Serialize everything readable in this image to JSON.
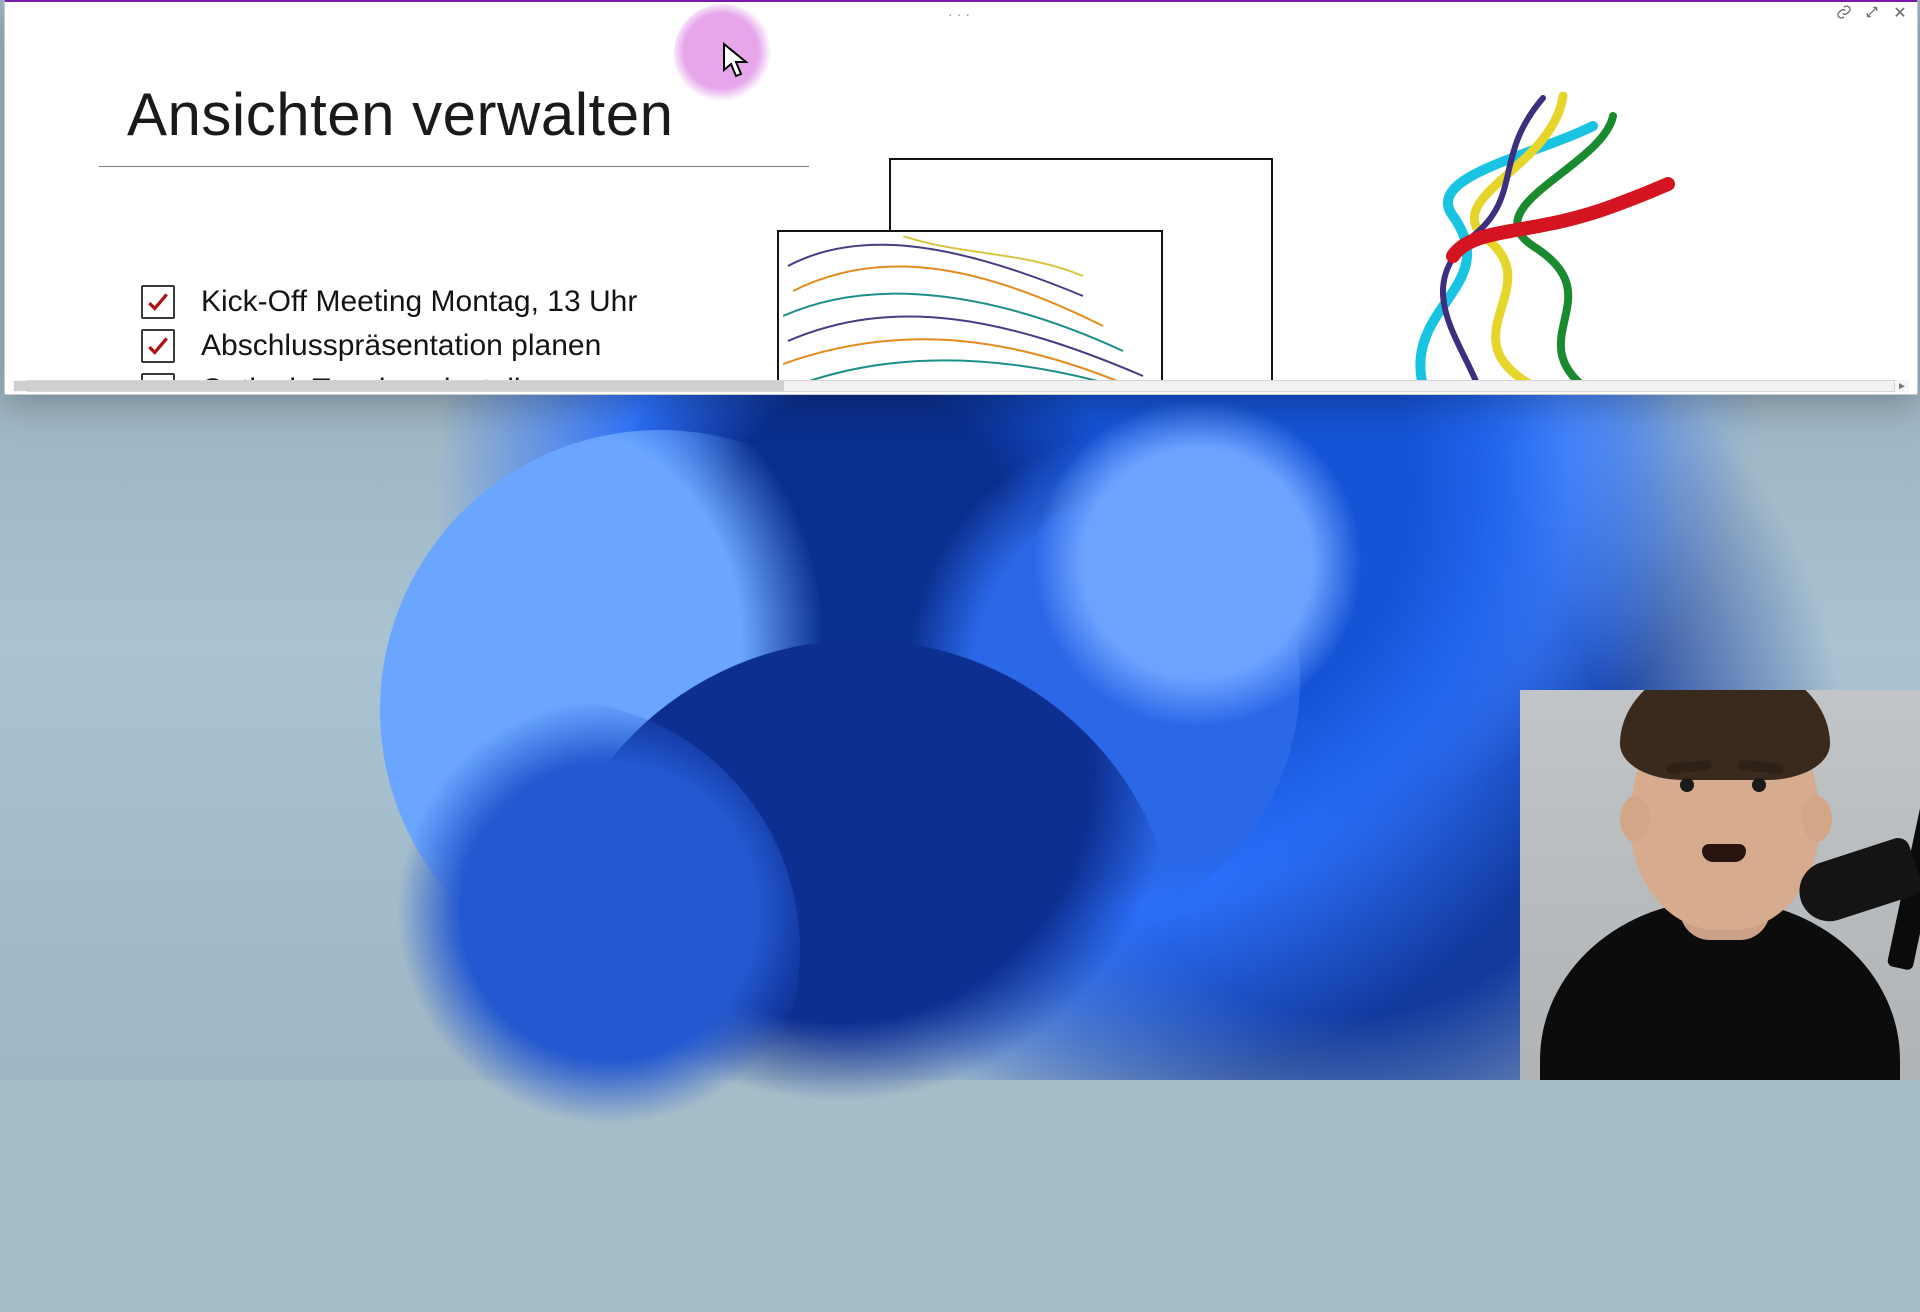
{
  "window": {
    "app_hint": "OneNote Quick Note",
    "drag_handle": "···",
    "buttons": {
      "page_link_tooltip": "Zur Seite wechseln",
      "expand_tooltip": "Vergrößern",
      "close_tooltip": "Schließen"
    }
  },
  "page": {
    "title": "Ansichten verwalten",
    "checklist": [
      {
        "label": "Kick-Off Meeting Montag, 13 Uhr",
        "checked": true
      },
      {
        "label": "Abschlusspräsentation planen",
        "checked": true
      },
      {
        "label": "Outlook Termine einstellen",
        "checked": false
      }
    ]
  },
  "cursor_highlight": {
    "shape": "circle",
    "color": "#e6a7ec"
  },
  "overlays": {
    "webcam_description": "Presenter webcam, bottom-right corner"
  }
}
